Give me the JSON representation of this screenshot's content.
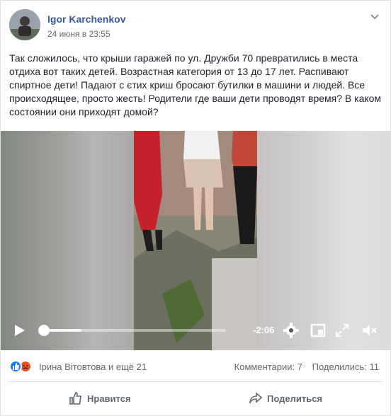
{
  "post": {
    "author": "Igor Karchenkov",
    "timestamp": "24 июня в 23:55",
    "text": "Так сложилось, что крыши гаражей по ул. Дружби 70 превратились в места отдиха вот таких детей. Возрастная категория от 13 до 17 лет. Распивают спиртное дети! Падают с єтих криш бросают бутилки в машини и людей. Все происходящее, просто жесть! Родители где ваши дети проводят время? В каком состоянии они приходят домой?"
  },
  "video": {
    "time_remaining": "-2:06",
    "progress": 0.0
  },
  "reactions": {
    "names": "Ірина Вітовтова и ещё 21",
    "comments": "Комментарии: 7",
    "shares": "Поделились: 11",
    "icons": [
      "like-icon",
      "angry-icon"
    ]
  },
  "actions": {
    "like_label": "Нравится",
    "share_label": "Поделиться"
  },
  "colors": {
    "brand": "#385898",
    "like_blue": "#1877f2",
    "angry_orange": "#f25022"
  }
}
